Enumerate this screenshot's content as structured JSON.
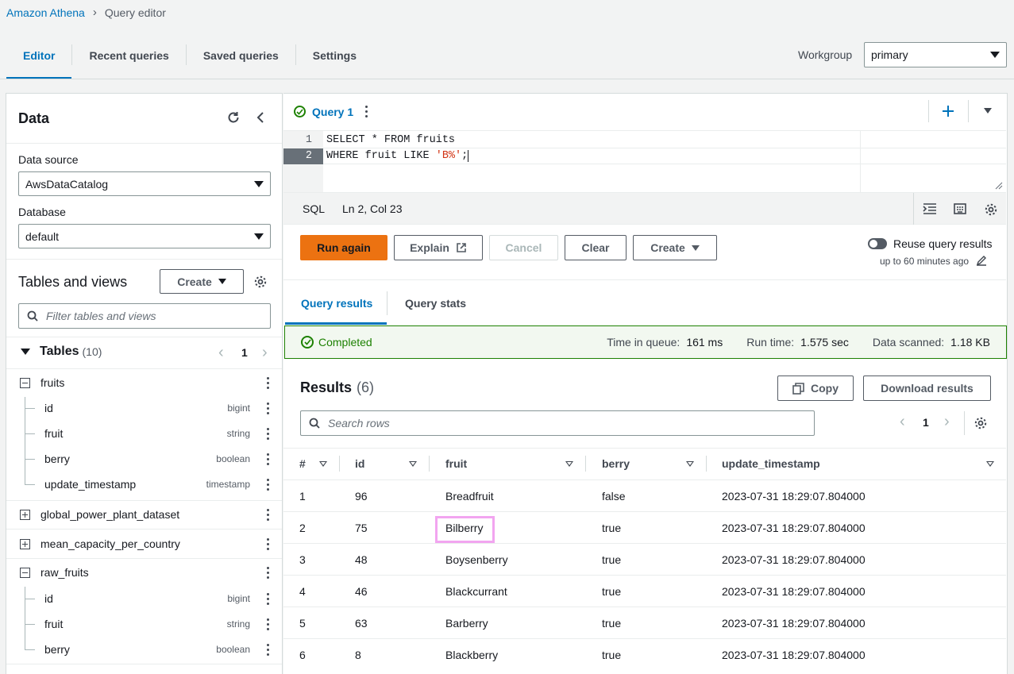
{
  "breadcrumb": {
    "root": "Amazon Athena",
    "current": "Query editor"
  },
  "tabs": [
    "Editor",
    "Recent queries",
    "Saved queries",
    "Settings"
  ],
  "workgroup": {
    "label": "Workgroup",
    "value": "primary"
  },
  "data_panel": {
    "title": "Data",
    "data_source_label": "Data source",
    "data_source_value": "AwsDataCatalog",
    "database_label": "Database",
    "database_value": "default",
    "tables_title": "Tables and views",
    "create_label": "Create",
    "filter_placeholder": "Filter tables and views",
    "tables_label": "Tables",
    "tables_count": "(10)",
    "page": "1",
    "tree": {
      "fruits": {
        "name": "fruits",
        "cols": [
          {
            "name": "id",
            "type": "bigint"
          },
          {
            "name": "fruit",
            "type": "string"
          },
          {
            "name": "berry",
            "type": "boolean"
          },
          {
            "name": "update_timestamp",
            "type": "timestamp"
          }
        ]
      },
      "gppd": "global_power_plant_dataset",
      "mcpc": "mean_capacity_per_country",
      "raw_fruits": {
        "name": "raw_fruits",
        "cols": [
          {
            "name": "id",
            "type": "bigint"
          },
          {
            "name": "fruit",
            "type": "string"
          },
          {
            "name": "berry",
            "type": "boolean"
          }
        ]
      }
    }
  },
  "query_tab": {
    "label": "Query 1"
  },
  "editor": {
    "lines": [
      "SELECT * FROM fruits",
      "WHERE fruit LIKE ",
      "'B%'",
      ";"
    ],
    "line_numbers": [
      "1",
      "2"
    ],
    "lang": "SQL",
    "position": "Ln 2, Col 23"
  },
  "actions": {
    "run": "Run again",
    "explain": "Explain",
    "cancel": "Cancel",
    "clear": "Clear",
    "create": "Create",
    "reuse": "Reuse query results",
    "reuse_sub": "up to 60 minutes ago"
  },
  "result_tabs": [
    "Query results",
    "Query stats"
  ],
  "status": {
    "text": "Completed",
    "queue_label": "Time in queue:",
    "queue_value": "161 ms",
    "run_label": "Run time:",
    "run_value": "1.575 sec",
    "scan_label": "Data scanned:",
    "scan_value": "1.18 KB"
  },
  "results": {
    "title": "Results",
    "count": "(6)",
    "copy": "Copy",
    "download": "Download results",
    "search_placeholder": "Search rows",
    "page": "1",
    "columns": [
      "#",
      "id",
      "fruit",
      "berry",
      "update_timestamp"
    ],
    "rows": [
      [
        "1",
        "96",
        "Breadfruit",
        "false",
        "2023-07-31 18:29:07.804000"
      ],
      [
        "2",
        "75",
        "Bilberry",
        "true",
        "2023-07-31 18:29:07.804000"
      ],
      [
        "3",
        "48",
        "Boysenberry",
        "true",
        "2023-07-31 18:29:07.804000"
      ],
      [
        "4",
        "46",
        "Blackcurrant",
        "true",
        "2023-07-31 18:29:07.804000"
      ],
      [
        "5",
        "63",
        "Barberry",
        "true",
        "2023-07-31 18:29:07.804000"
      ],
      [
        "6",
        "8",
        "Blackberry",
        "true",
        "2023-07-31 18:29:07.804000"
      ]
    ]
  },
  "colors": {
    "accent": "#0073bb",
    "primary_button": "#ec7211",
    "success": "#1d8102",
    "highlight": "#f2a5f0"
  }
}
